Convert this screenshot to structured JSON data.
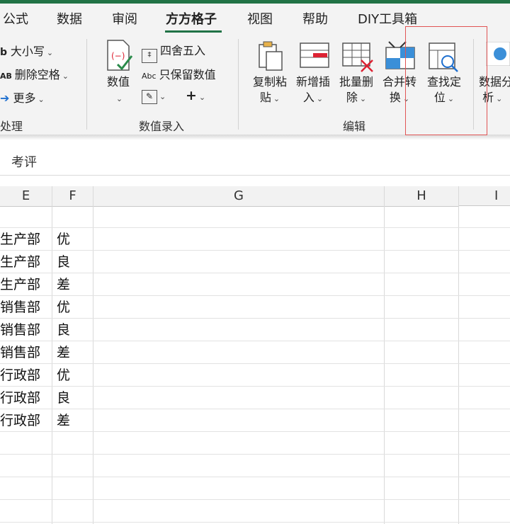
{
  "tabs": [
    {
      "label": "公式",
      "active": false
    },
    {
      "label": "数据",
      "active": false
    },
    {
      "label": "审阅",
      "active": false
    },
    {
      "label": "方方格子",
      "active": true
    },
    {
      "label": "视图",
      "active": false
    },
    {
      "label": "帮助",
      "active": false
    },
    {
      "label": "DIY工具箱",
      "active": false
    }
  ],
  "ribbon": {
    "text_group": {
      "case_label": "大小写",
      "remove_space_label": "删除空格",
      "more_label": "更多",
      "group_label": "处理"
    },
    "number_group": {
      "value_label": "数值",
      "round_label": "四舍五入",
      "keep_value_label": "只保留数值",
      "group_label": "数值录入"
    },
    "edit_group": {
      "copy_paste_label": [
        "复制粘",
        "贴"
      ],
      "insert_label": [
        "新增插",
        "入"
      ],
      "batch_delete_label": [
        "批量删",
        "除"
      ],
      "merge_label": [
        "合并转",
        "换"
      ],
      "find_label": [
        "查找定",
        "位"
      ],
      "group_label": "编辑"
    },
    "data_analysis_label": [
      "数据分",
      "析"
    ]
  },
  "formula_bar": {
    "text": "考评"
  },
  "columns": [
    "E",
    "F",
    "G",
    "H",
    "I"
  ],
  "rows": [
    {
      "e": "",
      "f": ""
    },
    {
      "e": "生产部",
      "f": "优"
    },
    {
      "e": "生产部",
      "f": "良"
    },
    {
      "e": "生产部",
      "f": "差"
    },
    {
      "e": "销售部",
      "f": "优"
    },
    {
      "e": "销售部",
      "f": "良"
    },
    {
      "e": "销售部",
      "f": "差"
    },
    {
      "e": "行政部",
      "f": "优"
    },
    {
      "e": "行政部",
      "f": "良"
    },
    {
      "e": "行政部",
      "f": "差"
    }
  ],
  "colors": {
    "accent": "#217346",
    "highlight": "#e05454"
  }
}
